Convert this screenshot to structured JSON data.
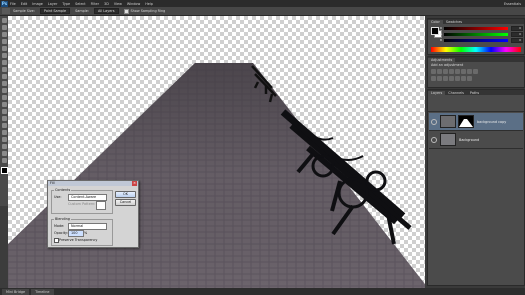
{
  "menubar": {
    "logo": "Ps",
    "items": [
      "File",
      "Edit",
      "Image",
      "Layer",
      "Type",
      "Select",
      "Filter",
      "3D",
      "View",
      "Window",
      "Help"
    ],
    "workspace": "Essentials"
  },
  "options": {
    "sample_size_label": "Sample Size:",
    "sample_size_value": "Point Sample",
    "sample_label": "Sample:",
    "sample_value": "All Layers",
    "show_ring_label": "Show Sampling Ring"
  },
  "panels": {
    "color_tab": "Color",
    "swatches_tab": "Swatches",
    "sliders": [
      {
        "label": "R",
        "value": "0",
        "color": "#ff0000"
      },
      {
        "label": "G",
        "value": "0",
        "color": "#00ff00"
      },
      {
        "label": "B",
        "value": "0",
        "color": "#0000ff"
      }
    ],
    "adjustments_tab": "Adjustments",
    "adjustments_title": "Add an adjustment",
    "layers_tab": "Layers",
    "channels_tab": "Channels",
    "paths_tab": "Paths",
    "layers": [
      {
        "name": "background copy",
        "selected": true
      },
      {
        "name": "Background",
        "selected": false
      }
    ]
  },
  "fill_dialog": {
    "title": "Fill",
    "contents_legend": "Contents",
    "use_label": "Use:",
    "use_value": "Content-Aware",
    "custom_pattern_label": "Custom Pattern:",
    "ok": "OK",
    "cancel": "Cancel",
    "blending_legend": "Blending",
    "mode_label": "Mode:",
    "mode_value": "Normal",
    "opacity_label": "Opacity:",
    "opacity_value": "100",
    "opacity_unit": "%",
    "preserve_label": "Preserve Transparency"
  },
  "statusbar": {
    "tabs": [
      "Mini Bridge",
      "Timeline"
    ]
  }
}
